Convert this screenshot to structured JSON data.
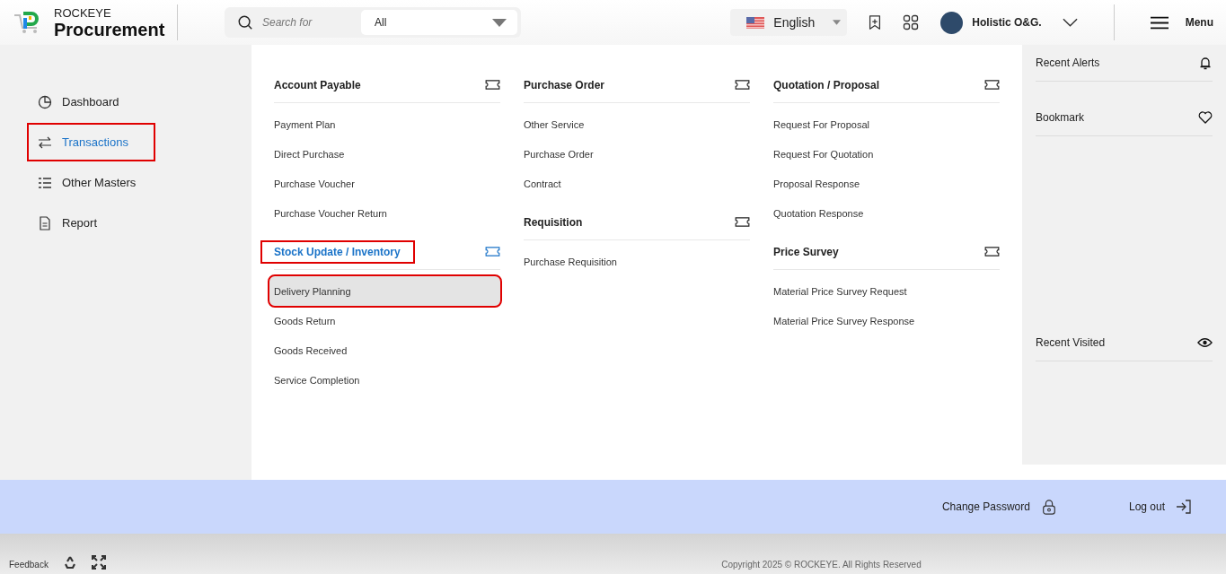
{
  "header": {
    "brand_top": "ROCKEYE",
    "brand_name": "Procurement",
    "search": {
      "placeholder": "Search for"
    },
    "filter": "All",
    "language": "English",
    "user": "Holistic O&G.",
    "menu": "Menu"
  },
  "sidebar": {
    "items": [
      {
        "label": "Dashboard",
        "kind": "dashboard",
        "selected": false,
        "highlighted": false
      },
      {
        "label": "Transactions",
        "kind": "transactions",
        "selected": true,
        "highlighted": true
      },
      {
        "label": "Other Masters",
        "kind": "masters",
        "selected": false,
        "highlighted": false
      },
      {
        "label": "Report",
        "kind": "report",
        "selected": false,
        "highlighted": false
      }
    ]
  },
  "menu_columns": [
    [
      {
        "title": "Account Payable",
        "selected": false,
        "highlighted": false,
        "items": [
          {
            "label": "Payment Plan",
            "selected": false,
            "highlighted": false
          },
          {
            "label": "Direct Purchase",
            "selected": false,
            "highlighted": false
          },
          {
            "label": "Purchase Voucher",
            "selected": false,
            "highlighted": false
          },
          {
            "label": "Purchase Voucher Return",
            "selected": false,
            "highlighted": false
          }
        ]
      },
      {
        "title": "Stock Update / Inventory",
        "selected": true,
        "highlighted": true,
        "items": [
          {
            "label": "Delivery Planning",
            "selected": true,
            "highlighted": true
          },
          {
            "label": "Goods Return",
            "selected": false,
            "highlighted": false
          },
          {
            "label": "Goods Received",
            "selected": false,
            "highlighted": false
          },
          {
            "label": "Service Completion",
            "selected": false,
            "highlighted": false
          }
        ]
      }
    ],
    [
      {
        "title": "Purchase Order",
        "selected": false,
        "highlighted": false,
        "items": [
          {
            "label": "Other Service",
            "selected": false,
            "highlighted": false
          },
          {
            "label": "Purchase Order",
            "selected": false,
            "highlighted": false
          },
          {
            "label": "Contract",
            "selected": false,
            "highlighted": false
          }
        ]
      },
      {
        "title": "Requisition",
        "selected": false,
        "highlighted": false,
        "items": [
          {
            "label": "Purchase Requisition",
            "selected": false,
            "highlighted": false
          }
        ]
      }
    ],
    [
      {
        "title": "Quotation / Proposal",
        "selected": false,
        "highlighted": false,
        "items": [
          {
            "label": "Request For Proposal",
            "selected": false,
            "highlighted": false
          },
          {
            "label": "Request For Quotation",
            "selected": false,
            "highlighted": false
          },
          {
            "label": "Proposal Response",
            "selected": false,
            "highlighted": false
          },
          {
            "label": "Quotation Response",
            "selected": false,
            "highlighted": false
          }
        ]
      },
      {
        "title": "Price Survey",
        "selected": false,
        "highlighted": false,
        "items": [
          {
            "label": "Material Price Survey Request",
            "selected": false,
            "highlighted": false
          },
          {
            "label": "Material Price Survey Response",
            "selected": false,
            "highlighted": false
          }
        ]
      }
    ]
  ],
  "right_panel": [
    {
      "label": "Recent Alerts",
      "kind": "alerts"
    },
    {
      "label": "Bookmark",
      "kind": "bookmark"
    },
    {
      "label": "Recent Visited",
      "kind": "visited"
    }
  ],
  "account_bar": [
    {
      "label": "Change Password",
      "kind": "password"
    },
    {
      "label": "Log out",
      "kind": "logout"
    }
  ],
  "footer": {
    "feedback": "Feedback",
    "copyright": "Copyright 2025 © ROCKEYE. All Rights Reserved"
  }
}
